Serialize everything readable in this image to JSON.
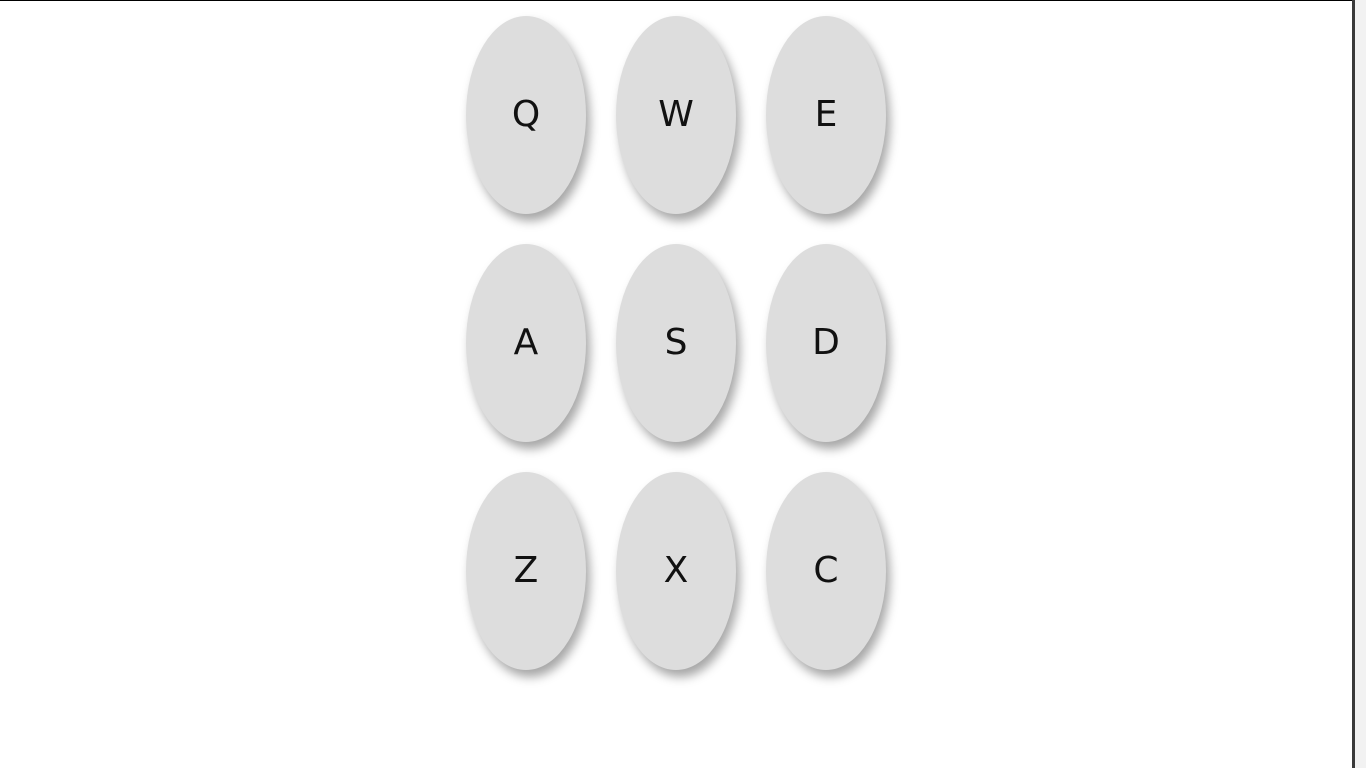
{
  "keypad": {
    "rows": [
      [
        "Q",
        "W",
        "E"
      ],
      [
        "A",
        "S",
        "D"
      ],
      [
        "Z",
        "X",
        "C"
      ]
    ],
    "key_color": "#dddddd",
    "text_color": "#111111"
  }
}
